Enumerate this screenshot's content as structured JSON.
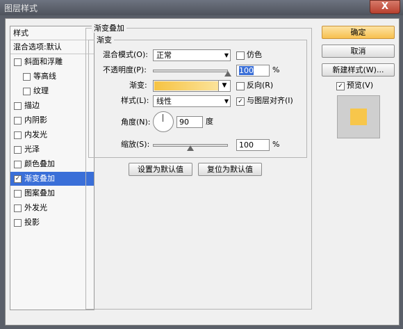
{
  "window": {
    "title": "图层样式",
    "close_glyph": "X"
  },
  "sidebar": {
    "header": "样式",
    "blend_default": "混合选项:默认",
    "items": [
      {
        "label": "斜面和浮雕",
        "checked": false,
        "checkmark": ""
      },
      {
        "label": "等高线",
        "checked": false,
        "checkmark": ""
      },
      {
        "label": "纹理",
        "checked": false,
        "checkmark": ""
      },
      {
        "label": "描边",
        "checked": false,
        "checkmark": ""
      },
      {
        "label": "内阴影",
        "checked": false,
        "checkmark": ""
      },
      {
        "label": "内发光",
        "checked": false,
        "checkmark": ""
      },
      {
        "label": "光泽",
        "checked": false,
        "checkmark": ""
      },
      {
        "label": "颜色叠加",
        "checked": false,
        "checkmark": ""
      },
      {
        "label": "渐变叠加",
        "checked": true,
        "checkmark": "✓"
      },
      {
        "label": "图案叠加",
        "checked": false,
        "checkmark": ""
      },
      {
        "label": "外发光",
        "checked": false,
        "checkmark": ""
      },
      {
        "label": "投影",
        "checked": false,
        "checkmark": ""
      }
    ]
  },
  "panel": {
    "section_title": "渐变叠加",
    "sub_title": "渐变",
    "blend_mode": {
      "label": "混合模式(O):",
      "value": "正常"
    },
    "dither": {
      "label": "仿色",
      "checked": false,
      "checkmark": ""
    },
    "opacity": {
      "label": "不透明度(P):",
      "value": "100",
      "unit": "%",
      "level": 1.0
    },
    "gradient": {
      "label": "渐变:",
      "color_start": "#f6c343",
      "color_end": "#fbe39a"
    },
    "reverse": {
      "label": "反向(R)",
      "checked": false,
      "checkmark": ""
    },
    "style": {
      "label": "样式(L):",
      "value": "线性"
    },
    "align_layer": {
      "label": "与图层对齐(I)",
      "checked": true,
      "checkmark": "✓"
    },
    "angle": {
      "label": "角度(N):",
      "value": "90",
      "unit": "度"
    },
    "scale": {
      "label": "缩放(S):",
      "value": "100",
      "unit": "%",
      "level": 0.5
    },
    "btn_set_default": "设置为默认值",
    "btn_reset_default": "复位为默认值",
    "dropdown_arrow": "▼"
  },
  "actions": {
    "ok": "确定",
    "cancel": "取消",
    "new_style": "新建样式(W)...",
    "preview": {
      "label": "预览(V)",
      "checked": true,
      "checkmark": "✓"
    }
  },
  "colors": {
    "selection": "#3a6fd8",
    "preview_swatch": "#f7c64b",
    "primary_button": "#f7c04f"
  }
}
